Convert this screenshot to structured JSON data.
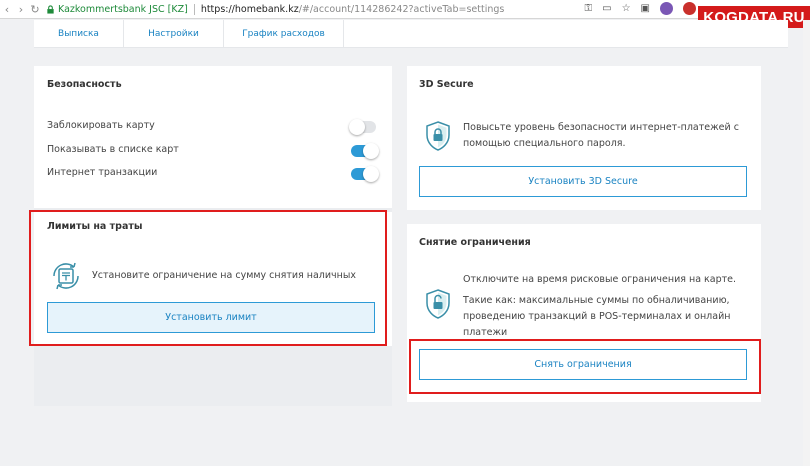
{
  "browser": {
    "ssl_label": "Kazkommertsbank JSC [KZ]",
    "url_host": "https://homebank.kz",
    "url_path": "/#/account/114286242?activeTab=settings"
  },
  "watermark": "KOGDATA.RU",
  "tabs": [
    {
      "label": "Выписка"
    },
    {
      "label": "Настройки"
    },
    {
      "label": "График расходов"
    }
  ],
  "security": {
    "title": "Безопасность",
    "items": [
      {
        "label": "Заблокировать карту",
        "enabled": false
      },
      {
        "label": "Показывать в списке карт",
        "enabled": true
      },
      {
        "label": "Интернет транзакции",
        "enabled": true
      }
    ]
  },
  "limits": {
    "title": "Лимиты на траты",
    "description": "Установите ограничение на сумму снятия наличных",
    "button": "Установить лимит"
  },
  "secure3d": {
    "title": "3D Secure",
    "description": "Повысьте уровень безопасности интернет-платежей с помощью специального пароля.",
    "button": "Установить 3D Secure"
  },
  "restrictions": {
    "title": "Снятие ограничения",
    "line1": "Отключите на время рисковые ограничения на карте.",
    "line2": "Такие как: максимальные суммы по обналичиванию, проведению транзакций в POS-терминалах и онлайн платежи",
    "button": "Снять ограничения"
  },
  "colors": {
    "accent": "#2d9ad6",
    "highlight": "#e01d1d",
    "shield": "#3a8fa8"
  }
}
